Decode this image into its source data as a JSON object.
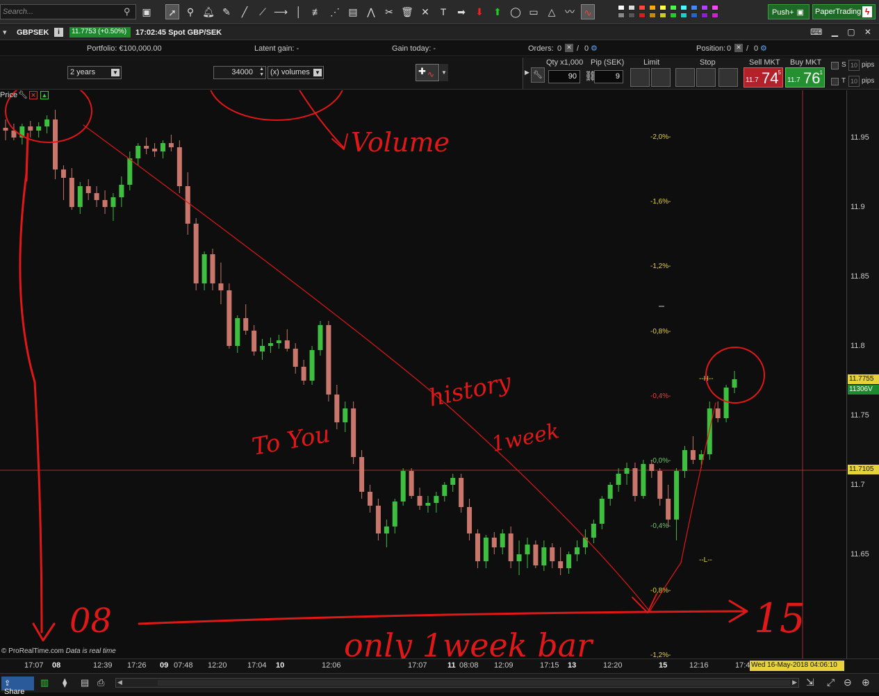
{
  "toolbar": {
    "search_placeholder": "Search...",
    "tools": [
      "pointer-icon",
      "zoom-icon",
      "alert-icon",
      "ruler-icon",
      "line-icon",
      "ray-icon",
      "hline-icon",
      "vline-icon",
      "fib-icon",
      "fan-icon",
      "fib-ext-icon",
      "pattern-icon",
      "tools-icon",
      "trash-icon",
      "cross-icon",
      "text-icon",
      "arrow-right-icon",
      "arrow-down-icon",
      "arrow-up-icon",
      "ellipse-icon",
      "rectangle-icon",
      "triangle-icon",
      "wave-icon",
      "indicator-icon"
    ],
    "push_label": "Push+",
    "paper_label": "PaperTrading"
  },
  "titlebar": {
    "symbol": "GBPSEK",
    "price_chip": "11.7753 (+0.50%)",
    "time_label": "17:02:45 Spot GBP/SEK"
  },
  "status": {
    "portfolio": "Portfolio:  €100,000.00",
    "latent_gain": "Latent gain:  -",
    "gain_today": "Gain today:  -",
    "orders_label": "Orders:",
    "orders_a": "0",
    "orders_b": "0",
    "position_label": "Position:",
    "position_a": "0",
    "position_b": "0"
  },
  "controls": {
    "period": "2 years",
    "volume_value": "34000",
    "volume_unit": "(x) volumes"
  },
  "order_panel": {
    "qty_label": "Qty x1,000",
    "qty_value": "90",
    "pip_label": "Pip (SEK)",
    "pip_value": "9",
    "limit_label": "Limit",
    "stop_label": "Stop",
    "sell_label": "Sell MKT",
    "sell_small": "11.7",
    "sell_big": "74",
    "sell_sup": "5",
    "buy_label": "Buy MKT",
    "buy_small": "11.7",
    "buy_big": "76",
    "buy_sup": "1",
    "s_label": "S",
    "s_pips": "10",
    "t_label": "T",
    "t_pips": "10",
    "pips_label": "pips"
  },
  "chart": {
    "price_label": "Price",
    "watermark": "ProRealTime.com",
    "realtime": "Data is real time",
    "y_ticks": [
      "11.95",
      "11.9",
      "11.85",
      "11.8",
      "11.75",
      "11.7",
      "11.65"
    ],
    "last_price": "11.7755",
    "last_volume": "11306V",
    "crosshair_price": "11.7105",
    "pct_labels": [
      "-2,0%-",
      "-1,6%-",
      "-1,2%-",
      "-0,8%-",
      "-0,4%-",
      "-0,0%-",
      "-0,4%-",
      "-0,8%-",
      "-1,2%-"
    ],
    "h_marker": "--H--",
    "l_marker": "--L--",
    "annotations": [
      "Volume",
      "history",
      "To You",
      "1week",
      "08",
      "15",
      "only 1week bar"
    ]
  },
  "x_ticks": [
    {
      "label": "17:07",
      "bold": false
    },
    {
      "label": "08",
      "bold": true
    },
    {
      "label": "12:39",
      "bold": false
    },
    {
      "label": "17:26",
      "bold": false
    },
    {
      "label": "09",
      "bold": true
    },
    {
      "label": "07:48",
      "bold": false
    },
    {
      "label": "12:20",
      "bold": false
    },
    {
      "label": "17:04",
      "bold": false
    },
    {
      "label": "10",
      "bold": true
    },
    {
      "label": "12:06",
      "bold": false
    },
    {
      "label": "17:07",
      "bold": false
    },
    {
      "label": "11",
      "bold": true
    },
    {
      "label": "08:08",
      "bold": false
    },
    {
      "label": "12:09",
      "bold": false
    },
    {
      "label": "17:15",
      "bold": false
    },
    {
      "label": "13",
      "bold": true
    },
    {
      "label": "12:20",
      "bold": false
    },
    {
      "label": "15",
      "bold": true
    },
    {
      "label": "12:16",
      "bold": false
    },
    {
      "label": "17:4",
      "bold": false
    }
  ],
  "date_badge": "Wed 16-May-2018 04:06:10",
  "bottom": {
    "share_label": "Share"
  },
  "colors": {
    "up": "#3fbf3f",
    "down": "#c9776c",
    "annotation": "#e01818",
    "accent_green": "#25902f",
    "accent_red": "#b3222a"
  }
}
